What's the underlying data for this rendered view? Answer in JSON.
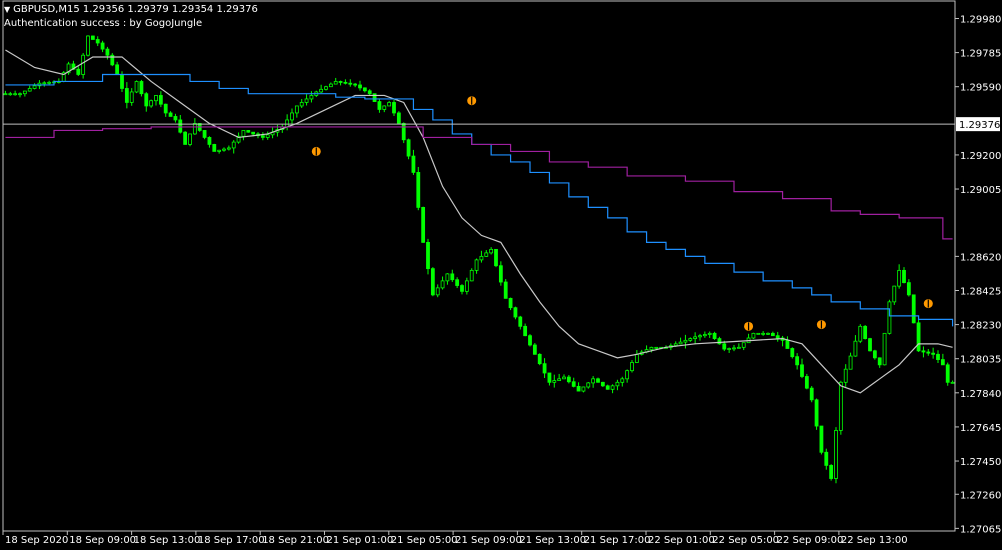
{
  "header": {
    "symbol_line": "GBPUSD,M15  1.29356 1.29379 1.29354 1.29376",
    "status_line": "Authentication success : by GogoJungle",
    "dropdown_icon": "triangle-down-icon"
  },
  "colors": {
    "background": "#000000",
    "frame": "#c0c0c0",
    "bull_candle": "#00ff00",
    "bear_candle": "#00ff00",
    "fast_ma": "#c8c8c8",
    "blue_line": "#1e90ff",
    "magenta_line": "#a020a0",
    "signal_marker": "#ff9900",
    "current_price_line": "#c0c0c0"
  },
  "chart_data": {
    "type": "candlestick",
    "symbol": "GBPUSD",
    "timeframe": "M15",
    "current_price": 1.29376,
    "y_ticks": [
      1.2998,
      1.29785,
      1.2959,
      1.292,
      1.29005,
      1.2862,
      1.28425,
      1.2823,
      1.28035,
      1.2784,
      1.27645,
      1.2745,
      1.2726,
      1.27065
    ],
    "y_tick_labels": [
      "1.29980",
      "1.29785",
      "1.29590",
      "1.29200",
      "1.29005",
      "1.28620",
      "1.28425",
      "1.28230",
      "1.28035",
      "1.27840",
      "1.27645",
      "1.27450",
      "1.27260",
      "1.27065"
    ],
    "current_price_label": "1.29376",
    "ylim": [
      1.2705,
      1.3008
    ],
    "x_labels": [
      "18 Sep 2020",
      "18 Sep 09:00",
      "18 Sep 13:00",
      "18 Sep 17:00",
      "18 Sep 21:00",
      "21 Sep 01:00",
      "21 Sep 05:00",
      "21 Sep 09:00",
      "21 Sep 13:00",
      "21 Sep 17:00",
      "22 Sep 01:00",
      "22 Sep 05:00",
      "22 Sep 09:00",
      "22 Sep 13:00"
    ],
    "price_path": [
      [
        0,
        1.2955
      ],
      [
        4,
        1.2955
      ],
      [
        8,
        1.2961
      ],
      [
        12,
        1.2962
      ],
      [
        14,
        1.2972
      ],
      [
        16,
        1.2966
      ],
      [
        18,
        1.2988
      ],
      [
        20,
        1.2984
      ],
      [
        22,
        1.2977
      ],
      [
        24,
        1.2966
      ],
      [
        26,
        1.295
      ],
      [
        28,
        1.2962
      ],
      [
        30,
        1.2948
      ],
      [
        32,
        1.2954
      ],
      [
        34,
        1.2944
      ],
      [
        36,
        1.294
      ],
      [
        38,
        1.2926
      ],
      [
        40,
        1.2938
      ],
      [
        44,
        1.2922
      ],
      [
        47,
        1.2924
      ],
      [
        50,
        1.2934
      ],
      [
        54,
        1.293
      ],
      [
        58,
        1.2936
      ],
      [
        61,
        1.2948
      ],
      [
        65,
        1.2956
      ],
      [
        69,
        1.2962
      ],
      [
        73,
        1.296
      ],
      [
        76,
        1.2955
      ],
      [
        78,
        1.2946
      ],
      [
        80,
        1.295
      ],
      [
        82,
        1.2938
      ],
      [
        85,
        1.291
      ],
      [
        87,
        1.287
      ],
      [
        89,
        1.284
      ],
      [
        92,
        1.2852
      ],
      [
        95,
        1.2842
      ],
      [
        98,
        1.286
      ],
      [
        101,
        1.2866
      ],
      [
        104,
        1.2838
      ],
      [
        107,
        1.2822
      ],
      [
        110,
        1.2806
      ],
      [
        113,
        1.279
      ],
      [
        116,
        1.2793
      ],
      [
        119,
        1.2785
      ],
      [
        122,
        1.2792
      ],
      [
        125,
        1.2786
      ],
      [
        128,
        1.2792
      ],
      [
        131,
        1.2806
      ],
      [
        134,
        1.281
      ],
      [
        137,
        1.281
      ],
      [
        140,
        1.2813
      ],
      [
        143,
        1.2816
      ],
      [
        146,
        1.2818
      ],
      [
        149,
        1.2809
      ],
      [
        152,
        1.281
      ],
      [
        155,
        1.2818
      ],
      [
        158,
        1.2818
      ],
      [
        161,
        1.2814
      ],
      [
        164,
        1.28
      ],
      [
        167,
        1.278
      ],
      [
        169,
        1.275
      ],
      [
        171,
        1.2735
      ],
      [
        173,
        1.279
      ],
      [
        175,
        1.2805
      ],
      [
        177,
        1.2822
      ],
      [
        179,
        1.2808
      ],
      [
        181,
        1.28
      ],
      [
        183,
        1.2836
      ],
      [
        185,
        1.2854
      ],
      [
        187,
        1.284
      ],
      [
        189,
        1.2808
      ],
      [
        192,
        1.2806
      ],
      [
        194,
        1.28
      ],
      [
        195,
        1.279
      ]
    ],
    "fast_ma": [
      [
        0,
        1.298
      ],
      [
        6,
        1.297
      ],
      [
        12,
        1.2966
      ],
      [
        18,
        1.2976
      ],
      [
        24,
        1.2976
      ],
      [
        30,
        1.2962
      ],
      [
        36,
        1.295
      ],
      [
        42,
        1.2938
      ],
      [
        48,
        1.293
      ],
      [
        54,
        1.2932
      ],
      [
        60,
        1.2938
      ],
      [
        66,
        1.2946
      ],
      [
        72,
        1.2954
      ],
      [
        78,
        1.2954
      ],
      [
        82,
        1.295
      ],
      [
        86,
        1.293
      ],
      [
        90,
        1.2902
      ],
      [
        94,
        1.2884
      ],
      [
        98,
        1.2874
      ],
      [
        102,
        1.287
      ],
      [
        106,
        1.2852
      ],
      [
        110,
        1.2836
      ],
      [
        114,
        1.2822
      ],
      [
        118,
        1.2812
      ],
      [
        122,
        1.2808
      ],
      [
        126,
        1.2804
      ],
      [
        130,
        1.2806
      ],
      [
        136,
        1.281
      ],
      [
        142,
        1.2812
      ],
      [
        148,
        1.2813
      ],
      [
        154,
        1.2814
      ],
      [
        160,
        1.2815
      ],
      [
        164,
        1.2812
      ],
      [
        168,
        1.28
      ],
      [
        172,
        1.2788
      ],
      [
        176,
        1.2784
      ],
      [
        180,
        1.2792
      ],
      [
        184,
        1.28
      ],
      [
        188,
        1.2812
      ],
      [
        192,
        1.2812
      ],
      [
        195,
        1.281
      ]
    ],
    "blue_line": [
      [
        0,
        1.296
      ],
      [
        10,
        1.2962
      ],
      [
        20,
        1.2966
      ],
      [
        30,
        1.2966
      ],
      [
        34,
        1.2966
      ],
      [
        38,
        1.2962
      ],
      [
        44,
        1.2958
      ],
      [
        50,
        1.2955
      ],
      [
        56,
        1.2955
      ],
      [
        62,
        1.2955
      ],
      [
        68,
        1.2953
      ],
      [
        74,
        1.2952
      ],
      [
        80,
        1.2952
      ],
      [
        84,
        1.2946
      ],
      [
        88,
        1.294
      ],
      [
        92,
        1.2932
      ],
      [
        96,
        1.2926
      ],
      [
        100,
        1.292
      ],
      [
        104,
        1.2916
      ],
      [
        108,
        1.291
      ],
      [
        112,
        1.2904
      ],
      [
        116,
        1.2896
      ],
      [
        120,
        1.289
      ],
      [
        124,
        1.2884
      ],
      [
        128,
        1.2876
      ],
      [
        132,
        1.287
      ],
      [
        136,
        1.2866
      ],
      [
        140,
        1.2862
      ],
      [
        144,
        1.2858
      ],
      [
        150,
        1.2853
      ],
      [
        156,
        1.2848
      ],
      [
        162,
        1.2844
      ],
      [
        166,
        1.284
      ],
      [
        170,
        1.2836
      ],
      [
        176,
        1.2832
      ],
      [
        182,
        1.2828
      ],
      [
        188,
        1.2826
      ],
      [
        195,
        1.2822
      ]
    ],
    "magenta_line": [
      [
        0,
        1.293
      ],
      [
        10,
        1.2934
      ],
      [
        20,
        1.2935
      ],
      [
        30,
        1.2936
      ],
      [
        40,
        1.2936
      ],
      [
        50,
        1.2936
      ],
      [
        60,
        1.2936
      ],
      [
        70,
        1.2936
      ],
      [
        80,
        1.2936
      ],
      [
        86,
        1.293
      ],
      [
        96,
        1.2926
      ],
      [
        104,
        1.2922
      ],
      [
        112,
        1.2916
      ],
      [
        120,
        1.2913
      ],
      [
        128,
        1.2908
      ],
      [
        140,
        1.2905
      ],
      [
        150,
        1.2899
      ],
      [
        160,
        1.2895
      ],
      [
        170,
        1.2888
      ],
      [
        176,
        1.2886
      ],
      [
        184,
        1.2884
      ],
      [
        190,
        1.2884
      ],
      [
        193,
        1.2872
      ],
      [
        195,
        1.2872
      ]
    ],
    "signal_markers": [
      {
        "i": 64,
        "price": 1.2922
      },
      {
        "i": 96,
        "price": 1.2951
      },
      {
        "i": 153,
        "price": 1.2822
      },
      {
        "i": 168,
        "price": 1.2823
      },
      {
        "i": 190,
        "price": 1.2835
      }
    ]
  }
}
